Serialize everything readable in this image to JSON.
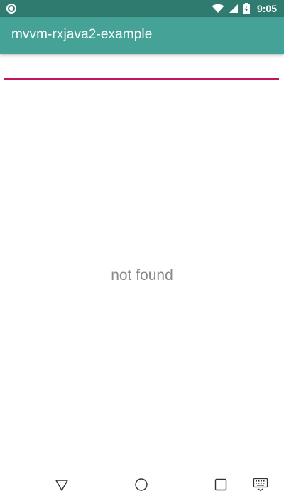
{
  "status_bar": {
    "time": "9:05",
    "icons": [
      "notification-dot-icon",
      "wifi-icon",
      "cell-signal-icon",
      "battery-charging-icon"
    ]
  },
  "app_bar": {
    "title": "mvvm-rxjava2-example"
  },
  "search": {
    "value": "",
    "placeholder": ""
  },
  "empty_state": {
    "text": "not found"
  },
  "nav_bar": {
    "buttons": [
      "back-icon",
      "home-icon",
      "recents-icon",
      "keyboard-icon"
    ]
  },
  "colors": {
    "status_bar": "#2f7b70",
    "app_bar": "#45a297",
    "input_underline": "#c2185b",
    "empty_text": "#8a8a8a"
  }
}
